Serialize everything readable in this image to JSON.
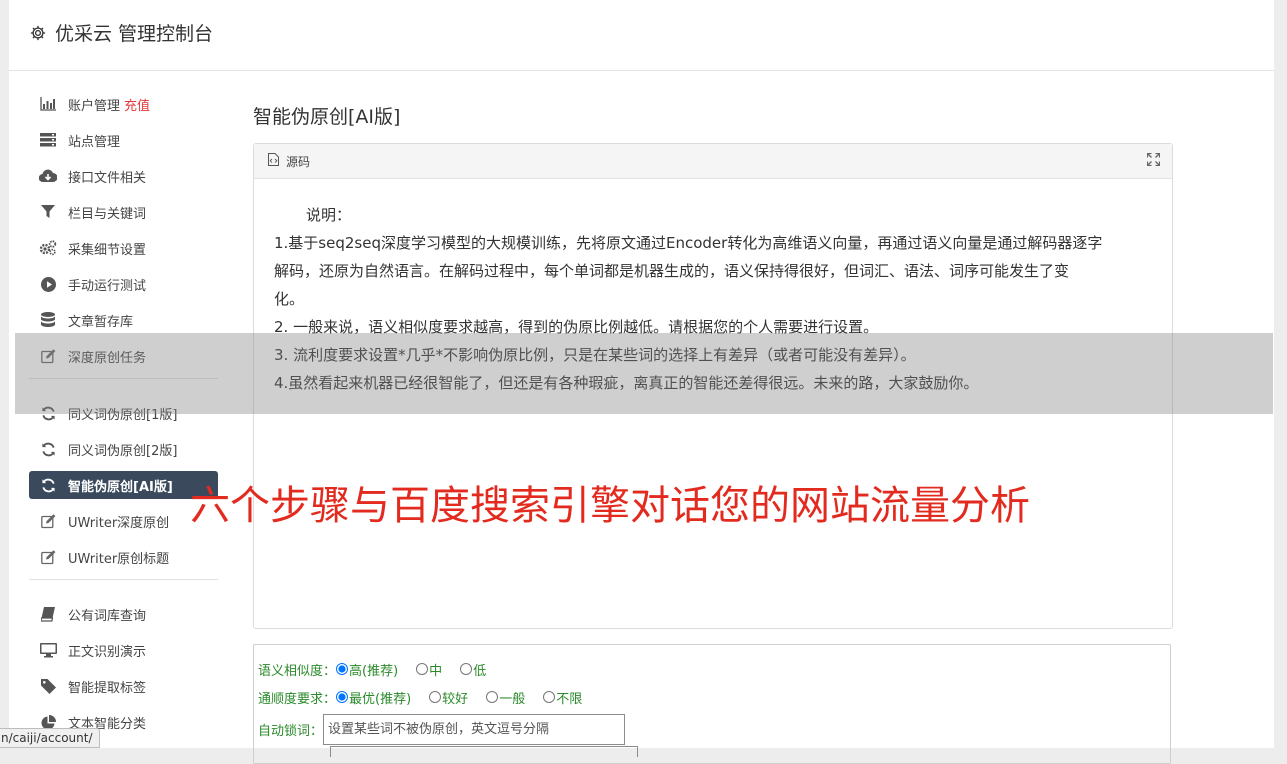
{
  "app": {
    "title": "优采云 管理控制台"
  },
  "sidebar": {
    "groups": [
      [
        {
          "label": "账户管理",
          "badge": "充值",
          "icon": "bar-chart-icon"
        },
        {
          "label": "站点管理",
          "icon": "server-icon"
        },
        {
          "label": "接口文件相关",
          "icon": "cloud-download-icon"
        },
        {
          "label": "栏目与关键词",
          "icon": "filter-icon"
        },
        {
          "label": "采集细节设置",
          "icon": "gears-icon"
        },
        {
          "label": "手动运行测试",
          "icon": "play-circle-icon"
        },
        {
          "label": "文章暂存库",
          "icon": "database-icon"
        },
        {
          "label": "深度原创任务",
          "icon": "edit-icon"
        }
      ],
      [
        {
          "label": "同义词伪原创[1版]",
          "icon": "refresh-icon"
        },
        {
          "label": "同义词伪原创[2版]",
          "icon": "refresh-icon"
        },
        {
          "label": "智能伪原创[AI版]",
          "icon": "refresh-icon",
          "active": true
        },
        {
          "label": "UWriter深度原创",
          "icon": "edit-icon"
        },
        {
          "label": "UWriter原创标题",
          "icon": "edit-icon"
        }
      ],
      [
        {
          "label": "公有词库查询",
          "icon": "book-icon"
        },
        {
          "label": "正文识别演示",
          "icon": "monitor-icon"
        },
        {
          "label": "智能提取标签",
          "icon": "tag-icon"
        },
        {
          "label": "文本智能分类",
          "icon": "pie-chart-icon"
        }
      ]
    ]
  },
  "main": {
    "page_title": "智能伪原创[AI版]",
    "panel": {
      "header_label": "源码",
      "desc_title": "说明：",
      "lines": [
        "1.基于seq2seq深度学习模型的大规模训练，先将原文通过Encoder转化为高维语义向量，再通过语义向量是通过解码器逐字",
        "解码，还原为自然语言。在解码过程中，每个单词都是机器生成的，语义保持得很好，但词汇、语法、词序可能发生了变",
        "化。",
        "2. 一般来说，语义相似度要求越高，得到的伪原比例越低。请根据您的个人需要进行设置。",
        "3. 流利度要求设置*几乎*不影响伪原比例，只是在某些词的选择上有差异（或者可能没有差异）。",
        "4.虽然看起来机器已经很智能了，但还是有各种瑕疵，离真正的智能还差得很远。未来的路，大家鼓励你。"
      ]
    },
    "form": {
      "similarity": {
        "label": "语义相似度：",
        "options": [
          "高(推荐)",
          "中",
          "低"
        ],
        "selected": "高(推荐)"
      },
      "fluency": {
        "label": "通顺度要求：",
        "options": [
          "最优(推荐)",
          "较好",
          "一般",
          "不限"
        ],
        "selected": "最优(推荐)"
      },
      "lock": {
        "label": "自动锁词：",
        "placeholder": "设置某些词不被伪原创，英文逗号分隔"
      }
    }
  },
  "overlay": {
    "headline": "六个步骤与百度搜索引擎对话您的网站流量分析"
  },
  "status": {
    "url": "n/caiji/account/"
  },
  "colors": {
    "active_nav": "#3a4a5c",
    "accent_red": "#e32a1e",
    "option_green": "#2a8a2a"
  }
}
